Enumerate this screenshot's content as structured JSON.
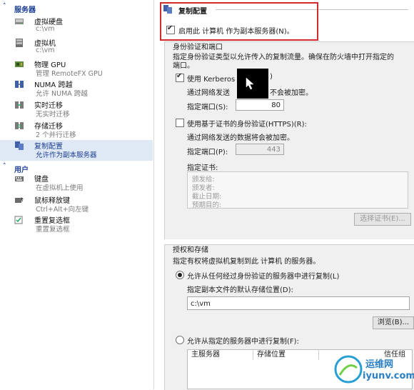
{
  "sidebar": {
    "section_server": "服务器",
    "section_user": "用户",
    "items": [
      {
        "title": "虚拟硬盘",
        "sub": "c:\\vm",
        "icon": "disk-icon"
      },
      {
        "title": "虚拟机",
        "sub": "c:\\vm",
        "icon": "vm-icon"
      },
      {
        "title": "物理 GPU",
        "sub": "管理 RemoteFX GPU",
        "icon": "gpu-icon"
      },
      {
        "title": "NUMA 跨越",
        "sub": "允许 NUMA 跨越",
        "icon": "numa-icon"
      },
      {
        "title": "实时迁移",
        "sub": "无实时迁移",
        "icon": "migration-icon"
      },
      {
        "title": "存储迁移",
        "sub": "2 个并行迁移",
        "icon": "storage-migration-icon"
      },
      {
        "title": "复制配置",
        "sub": "允许作为副本服务器",
        "icon": "replication-icon"
      }
    ],
    "user_items": [
      {
        "title": "键盘",
        "sub": "在虚拟机上使用",
        "icon": "keyboard-icon"
      },
      {
        "title": "鼠标释放键",
        "sub": "Ctrl+Alt+向左键",
        "icon": "mouse-icon"
      },
      {
        "title": "重置复选框",
        "sub": "重置复选框",
        "icon": "reset-icon"
      }
    ]
  },
  "main": {
    "header_title": "复制配置",
    "enable_replica_label": "启用此 计算机 作为副本服务器(N)。",
    "auth_group_title": "身份验证和端口",
    "auth_desc_line1": "指定身份验证类型以允许传入的复制流量。确保在防火墙中打开指定的",
    "auth_desc_line2": "端口。",
    "kerberos_label": "使用 Kerberos (",
    "kerberos_label_tail": ")",
    "kerberos_desc_a": "通过网络发送",
    "kerberos_desc_b": "不会被加密。",
    "port_label": "指定端口(S):",
    "kerberos_port": "80",
    "cert_label": "使用基于证书的身份验证(HTTPS)(R):",
    "cert_desc": "通过网络发送的数据将会被加密。",
    "cert_port_label": "指定端口(P):",
    "cert_port": "443",
    "cert_field_label": "指定证书:",
    "cert_lines": [
      "颁发给:",
      "颁发者:",
      "截止日期:",
      "预期目的:"
    ],
    "select_cert_button": "选择证书(E)...",
    "authz_group_title": "授权和存储",
    "authz_desc": "指定有权将虚拟机复制到此 计算机 的服务器。",
    "allow_any_label": "允许从任何经过身份验证的服务器中进行复制(L)",
    "storage_location_label": "指定副本文件的默认存储位置(D):",
    "storage_path": "c:\\vm",
    "browse_button": "浏览(B)...",
    "allow_specified_label": "允许从指定的服务器中进行复制(F):",
    "table_headers": [
      "主服务器",
      "存储位置",
      "信任组"
    ]
  },
  "watermark": {
    "brand": "运维网",
    "url": "iyunv.com"
  }
}
